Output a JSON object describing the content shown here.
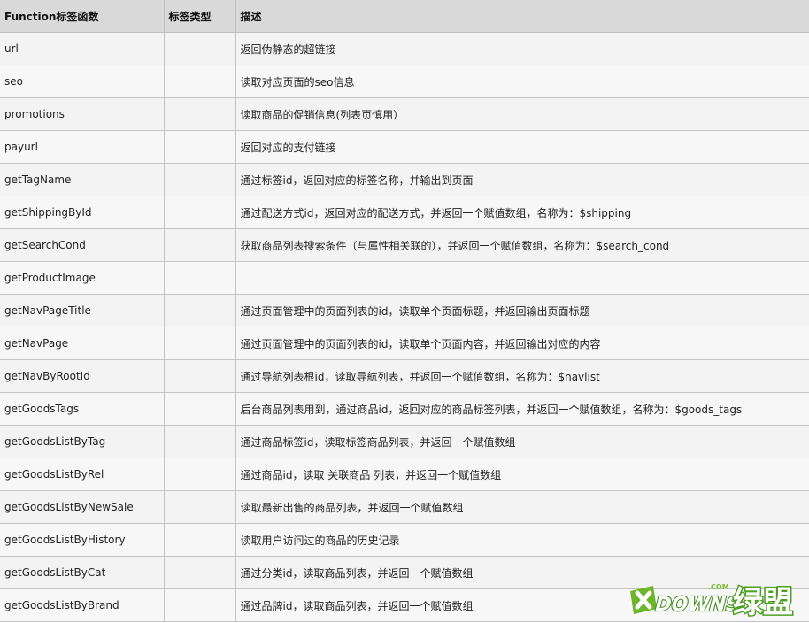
{
  "table": {
    "headers": [
      "Function标签函数",
      "标签类型",
      "描述"
    ],
    "rows": [
      {
        "func": "url",
        "type": "",
        "desc": "返回伪静态的超链接"
      },
      {
        "func": "seo",
        "type": "",
        "desc": "读取对应页面的seo信息"
      },
      {
        "func": "promotions",
        "type": "",
        "desc": "读取商品的促销信息(列表页慎用）"
      },
      {
        "func": "payurl",
        "type": "",
        "desc": "返回对应的支付链接"
      },
      {
        "func": "getTagName",
        "type": "",
        "desc": "通过标签id，返回对应的标签名称，并输出到页面"
      },
      {
        "func": "getShippingById",
        "type": "",
        "desc": "通过配送方式id，返回对应的配送方式，并返回一个赋值数组，名称为：$shipping"
      },
      {
        "func": "getSearchCond",
        "type": "",
        "desc": "获取商品列表搜索条件（与属性相关联的），并返回一个赋值数组，名称为：$search_cond"
      },
      {
        "func": "getProductImage",
        "type": "",
        "desc": ""
      },
      {
        "func": "getNavPageTitle",
        "type": "",
        "desc": "通过页面管理中的页面列表的id，读取单个页面标题，并返回输出页面标题"
      },
      {
        "func": "getNavPage",
        "type": "",
        "desc": "通过页面管理中的页面列表的id，读取单个页面内容，并返回输出对应的内容"
      },
      {
        "func": "getNavByRootId",
        "type": "",
        "desc": "通过导航列表根id，读取导航列表，并返回一个赋值数组，名称为：$navlist"
      },
      {
        "func": "getGoodsTags",
        "type": "",
        "desc": "后台商品列表用到，通过商品id，返回对应的商品标签列表，并返回一个赋值数组，名称为：$goods_tags"
      },
      {
        "func": "getGoodsListByTag",
        "type": "",
        "desc": "通过商品标签id，读取标签商品列表，并返回一个赋值数组"
      },
      {
        "func": "getGoodsListByRel",
        "type": "",
        "desc": "通过商品id，读取 关联商品 列表，并返回一个赋值数组"
      },
      {
        "func": "getGoodsListByNewSale",
        "type": "",
        "desc": "读取最新出售的商品列表，并返回一个赋值数组"
      },
      {
        "func": "getGoodsListByHistory",
        "type": "",
        "desc": "读取用户访问过的商品的历史记录"
      },
      {
        "func": "getGoodsListByCat",
        "type": "",
        "desc": "通过分类id，读取商品列表，并返回一个赋值数组"
      },
      {
        "func": "getGoodsListByBrand",
        "type": "",
        "desc": "通过品牌id，读取商品列表，并返回一个赋值数组"
      }
    ]
  },
  "watermark": {
    "text": "XDOWNS绿盟",
    "domain": ".COM",
    "colors": {
      "green": "#7bbf2a",
      "dark_green": "#3f8f1f"
    }
  }
}
